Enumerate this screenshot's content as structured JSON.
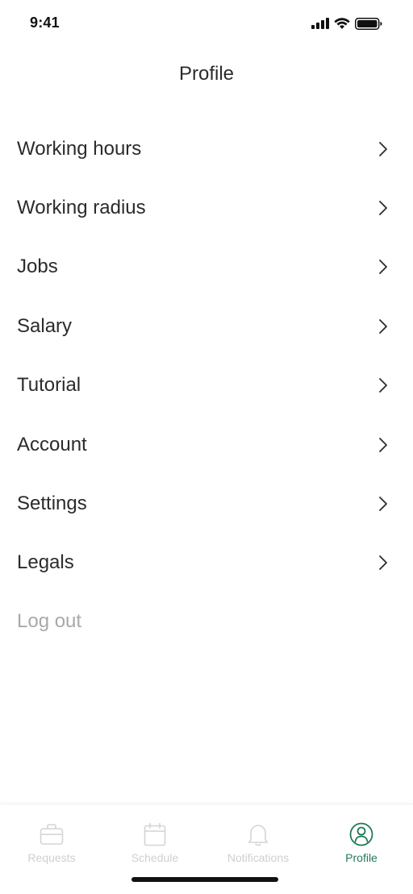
{
  "status_bar": {
    "time": "9:41"
  },
  "header": {
    "title": "Profile"
  },
  "menu": {
    "items": [
      {
        "label": "Working hours"
      },
      {
        "label": "Working radius"
      },
      {
        "label": "Jobs"
      },
      {
        "label": "Salary"
      },
      {
        "label": "Tutorial"
      },
      {
        "label": "Account"
      },
      {
        "label": "Settings"
      },
      {
        "label": "Legals"
      }
    ],
    "logout_label": "Log out"
  },
  "tab_bar": {
    "tabs": [
      {
        "label": "Requests",
        "icon": "briefcase-icon",
        "active": false
      },
      {
        "label": "Schedule",
        "icon": "calendar-icon",
        "active": false
      },
      {
        "label": "Notifications",
        "icon": "bell-icon",
        "active": false
      },
      {
        "label": "Profile",
        "icon": "user-circle-icon",
        "active": true
      }
    ]
  },
  "colors": {
    "accent": "#1f7a55",
    "text": "#2b2b2b",
    "muted": "#a9a9a9",
    "inactive_tab": "#cfcfcf"
  }
}
